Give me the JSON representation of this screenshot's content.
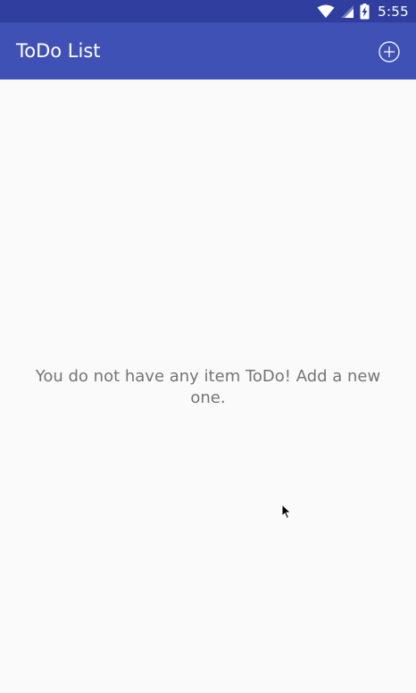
{
  "status_bar": {
    "time": "5:55",
    "icons": [
      "wifi-icon",
      "signal-icon",
      "battery-charging-icon"
    ]
  },
  "app_bar": {
    "title": "ToDo List",
    "add_icon": "add-circle-icon"
  },
  "main": {
    "empty_message": "You do not have any item ToDo! Add a new one."
  },
  "colors": {
    "status_bar": "#303f9f",
    "app_bar": "#3f51b5",
    "background": "#fafafa",
    "message_text": "#757575"
  }
}
